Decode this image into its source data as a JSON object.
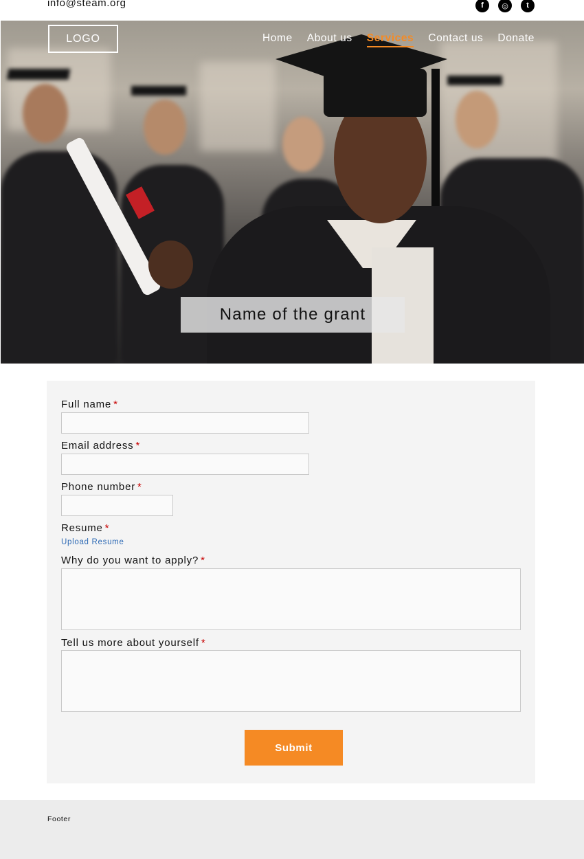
{
  "topbar": {
    "email": "info@steam.org"
  },
  "social": [
    {
      "icon": "facebook-icon",
      "glyph": "f"
    },
    {
      "icon": "instagram-icon",
      "glyph": "◎"
    },
    {
      "icon": "twitter-icon",
      "glyph": "t"
    }
  ],
  "header": {
    "logo": "LOGO",
    "nav": [
      {
        "label": "Home",
        "active": false
      },
      {
        "label": "About us",
        "active": false
      },
      {
        "label": "Services",
        "active": true
      },
      {
        "label": "Contact us",
        "active": false
      },
      {
        "label": "Donate",
        "active": false
      }
    ]
  },
  "hero": {
    "title": "Name of the grant"
  },
  "form": {
    "required_mark": "*",
    "full_name_label": "Full name",
    "email_label": "Email address",
    "phone_label": "Phone number",
    "resume_label": "Resume",
    "upload_label": "Upload Resume",
    "why_label": "Why do you want to apply?",
    "about_label": "Tell us more about yourself",
    "submit_label": "Submit"
  },
  "footer": {
    "text": "Footer"
  },
  "colors": {
    "accent": "#f58a24",
    "required": "#c70000",
    "link": "#2f6bb5"
  }
}
